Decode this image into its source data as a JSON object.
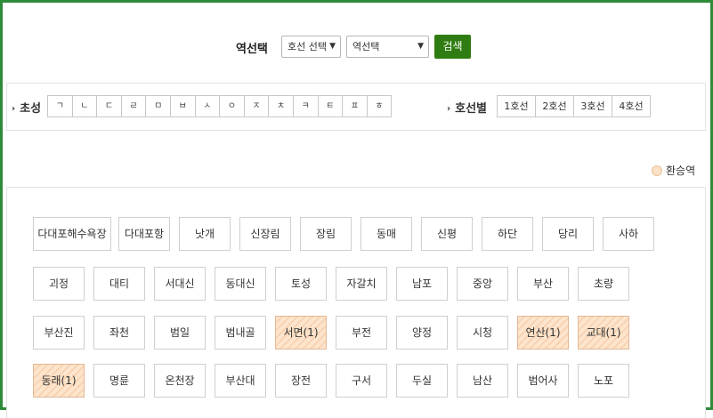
{
  "search": {
    "label": "역선택",
    "line_select": "호선 선택",
    "station_select": "역선택",
    "button": "검색"
  },
  "filter": {
    "choseong_label": "초성",
    "jamo": [
      "ㄱ",
      "ㄴ",
      "ㄷ",
      "ㄹ",
      "ㅁ",
      "ㅂ",
      "ㅅ",
      "ㅇ",
      "ㅈ",
      "ㅊ",
      "ㅋ",
      "ㅌ",
      "ㅍ",
      "ㅎ"
    ],
    "line_label": "호선별",
    "lines": [
      "1호선",
      "2호선",
      "3호선",
      "4호선"
    ]
  },
  "legend": {
    "transfer_label": "환승역",
    "transfer_color": "#fbe1c8"
  },
  "stations": [
    [
      {
        "name": "다대포해수욕장",
        "transfer": false,
        "wide": true
      },
      {
        "name": "다대포항",
        "transfer": false
      },
      {
        "name": "낫개",
        "transfer": false
      },
      {
        "name": "신장림",
        "transfer": false
      },
      {
        "name": "장림",
        "transfer": false
      },
      {
        "name": "동매",
        "transfer": false
      },
      {
        "name": "신평",
        "transfer": false
      },
      {
        "name": "하단",
        "transfer": false
      },
      {
        "name": "당리",
        "transfer": false
      },
      {
        "name": "사하",
        "transfer": false
      }
    ],
    [
      {
        "name": "괴정",
        "transfer": false
      },
      {
        "name": "대티",
        "transfer": false
      },
      {
        "name": "서대신",
        "transfer": false
      },
      {
        "name": "동대신",
        "transfer": false
      },
      {
        "name": "토성",
        "transfer": false
      },
      {
        "name": "자갈치",
        "transfer": false
      },
      {
        "name": "남포",
        "transfer": false
      },
      {
        "name": "중앙",
        "transfer": false
      },
      {
        "name": "부산",
        "transfer": false
      },
      {
        "name": "초량",
        "transfer": false
      }
    ],
    [
      {
        "name": "부산진",
        "transfer": false
      },
      {
        "name": "좌천",
        "transfer": false
      },
      {
        "name": "범일",
        "transfer": false
      },
      {
        "name": "범내골",
        "transfer": false
      },
      {
        "name": "서면(1)",
        "transfer": true
      },
      {
        "name": "부전",
        "transfer": false
      },
      {
        "name": "양정",
        "transfer": false
      },
      {
        "name": "시청",
        "transfer": false
      },
      {
        "name": "연산(1)",
        "transfer": true
      },
      {
        "name": "교대(1)",
        "transfer": true
      }
    ],
    [
      {
        "name": "동래(1)",
        "transfer": true
      },
      {
        "name": "명륜",
        "transfer": false
      },
      {
        "name": "온천장",
        "transfer": false
      },
      {
        "name": "부산대",
        "transfer": false
      },
      {
        "name": "장전",
        "transfer": false
      },
      {
        "name": "구서",
        "transfer": false
      },
      {
        "name": "두실",
        "transfer": false
      },
      {
        "name": "남산",
        "transfer": false
      },
      {
        "name": "범어사",
        "transfer": false
      },
      {
        "name": "노포",
        "transfer": false
      }
    ]
  ]
}
